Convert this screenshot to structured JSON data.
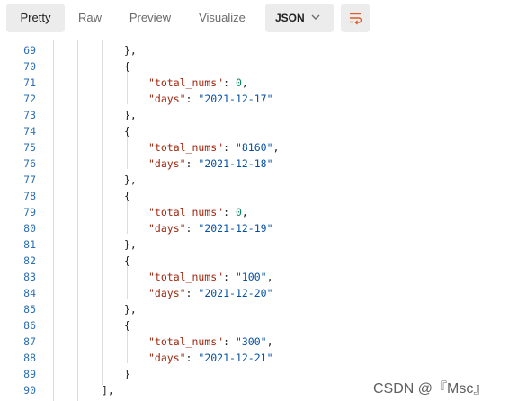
{
  "toolbar": {
    "tabs": [
      {
        "label": "Pretty",
        "active": true
      },
      {
        "label": "Raw",
        "active": false
      },
      {
        "label": "Preview",
        "active": false
      },
      {
        "label": "Visualize",
        "active": false
      }
    ],
    "format_select": "JSON",
    "wrap_icon": "wrap-lines-icon"
  },
  "colors": {
    "line_number": "#2c6fb5",
    "key": "#a1260d",
    "string": "#0451a5",
    "number": "#098658",
    "accent": "#e05c2a"
  },
  "editor": {
    "lines": [
      {
        "n": "69",
        "text": "},"
      },
      {
        "n": "70",
        "text": "{"
      },
      {
        "n": "71",
        "key": "\"total_nums\"",
        "value": "0",
        "value_type": "number",
        "trail": ","
      },
      {
        "n": "72",
        "key": "\"days\"",
        "value": "\"2021-12-17\"",
        "value_type": "string",
        "trail": ""
      },
      {
        "n": "73",
        "text": "},"
      },
      {
        "n": "74",
        "text": "{"
      },
      {
        "n": "75",
        "key": "\"total_nums\"",
        "value": "\"8160\"",
        "value_type": "string",
        "trail": ","
      },
      {
        "n": "76",
        "key": "\"days\"",
        "value": "\"2021-12-18\"",
        "value_type": "string",
        "trail": ""
      },
      {
        "n": "77",
        "text": "},"
      },
      {
        "n": "78",
        "text": "{"
      },
      {
        "n": "79",
        "key": "\"total_nums\"",
        "value": "0",
        "value_type": "number",
        "trail": ","
      },
      {
        "n": "80",
        "key": "\"days\"",
        "value": "\"2021-12-19\"",
        "value_type": "string",
        "trail": ""
      },
      {
        "n": "81",
        "text": "},"
      },
      {
        "n": "82",
        "text": "{"
      },
      {
        "n": "83",
        "key": "\"total_nums\"",
        "value": "\"100\"",
        "value_type": "string",
        "trail": ","
      },
      {
        "n": "84",
        "key": "\"days\"",
        "value": "\"2021-12-20\"",
        "value_type": "string",
        "trail": ""
      },
      {
        "n": "85",
        "text": "},"
      },
      {
        "n": "86",
        "text": "{"
      },
      {
        "n": "87",
        "key": "\"total_nums\"",
        "value": "\"300\"",
        "value_type": "string",
        "trail": ","
      },
      {
        "n": "88",
        "key": "\"days\"",
        "value": "\"2021-12-21\"",
        "value_type": "string",
        "trail": ""
      },
      {
        "n": "89",
        "text": "}"
      },
      {
        "n": "90",
        "text": "],"
      }
    ]
  },
  "watermark": "CSDN @『Msc』"
}
